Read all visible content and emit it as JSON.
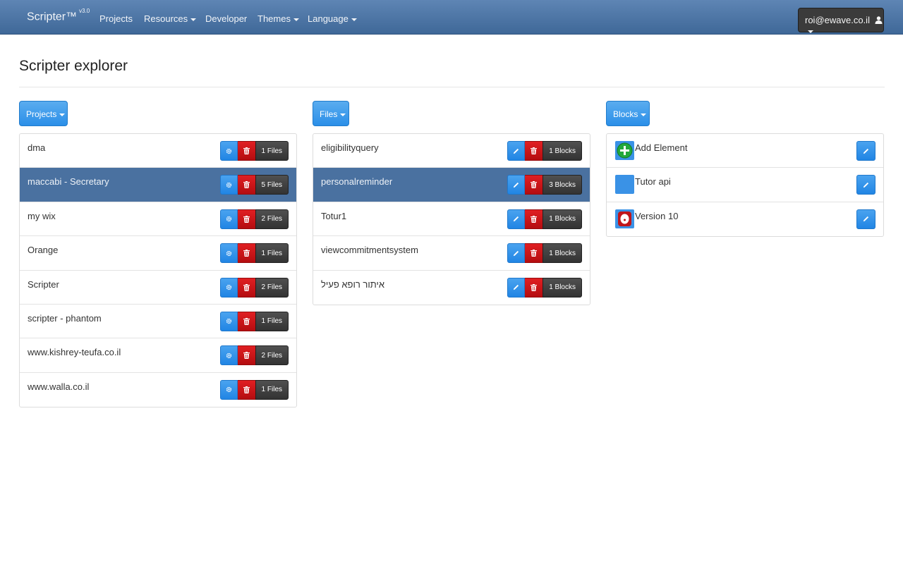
{
  "app": {
    "brand": "Scripter™",
    "version": "v3.0"
  },
  "nav": {
    "projects": "Projects",
    "resources": "Resources",
    "developer": "Developer",
    "themes": "Themes",
    "language": "Language",
    "user": "roi@ewave.co.il"
  },
  "page": {
    "title": "Scripter explorer"
  },
  "columns": {
    "projects_label": "Projects",
    "files_label": "Files",
    "blocks_label": "Blocks"
  },
  "projects": [
    {
      "name": "dma",
      "count": "1 Files"
    },
    {
      "name": "maccabi - Secretary",
      "count": "5 Files"
    },
    {
      "name": "my wix",
      "count": "2 Files"
    },
    {
      "name": "Orange",
      "count": "1 Files"
    },
    {
      "name": "Scripter",
      "count": "2 Files"
    },
    {
      "name": "scripter - phantom",
      "count": "1 Files"
    },
    {
      "name": "www.kishrey-teufa.co.il",
      "count": "2 Files"
    },
    {
      "name": "www.walla.co.il",
      "count": "1 Files"
    }
  ],
  "files": [
    {
      "name": "eligibilityquery",
      "count": "1 Blocks"
    },
    {
      "name": "personalreminder",
      "count": "3 Blocks"
    },
    {
      "name": "Totur1",
      "count": "1 Blocks"
    },
    {
      "name": "viewcommitmentsystem",
      "count": "1 Blocks"
    },
    {
      "name": "איתור רופא פעיל",
      "count": "1 Blocks"
    }
  ],
  "blocks": [
    {
      "name": "Add Element"
    },
    {
      "name": "Tutor api"
    },
    {
      "name": "Version 10"
    }
  ],
  "colors": {
    "navbar": "#4a71a0",
    "active_row": "#4a71a0",
    "primary": "#2b8fe8",
    "danger": "#c41215",
    "dark": "#3b3b3b"
  }
}
